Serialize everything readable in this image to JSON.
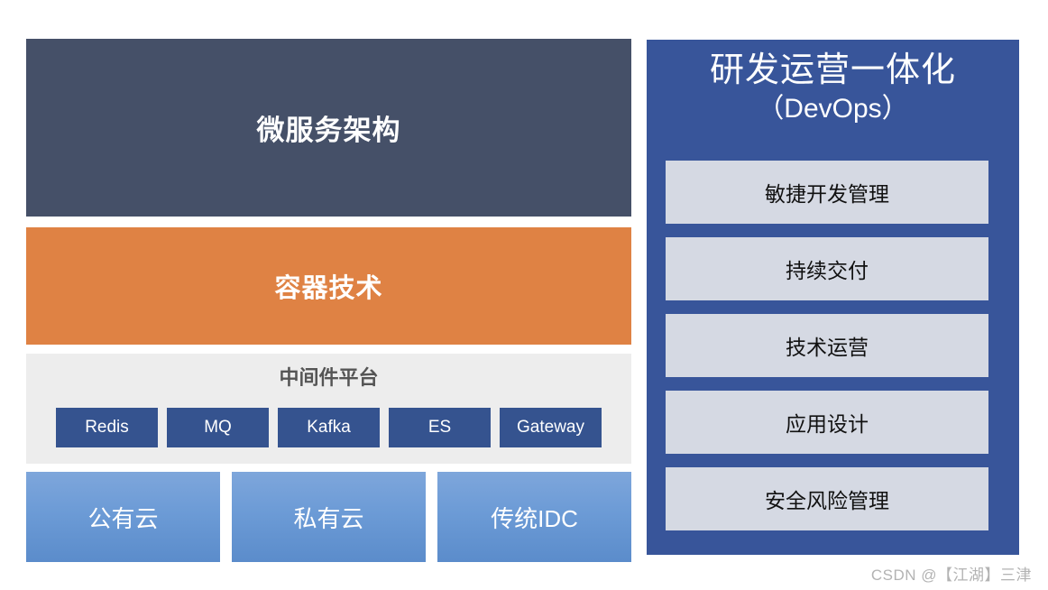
{
  "left_column": {
    "microservices": {
      "label": "微服务架构",
      "color": "#455068"
    },
    "container_tech": {
      "label": "容器技术",
      "color": "#DF8244"
    },
    "middleware": {
      "title": "中间件平台",
      "color": "#EDEDED",
      "chip_color": "#35538F",
      "chips": [
        {
          "label": "Redis"
        },
        {
          "label": "MQ"
        },
        {
          "label": "Kafka"
        },
        {
          "label": "ES"
        },
        {
          "label": "Gateway"
        }
      ]
    },
    "infrastructure": {
      "color": "#6C9BD6",
      "items": [
        {
          "label": "公有云"
        },
        {
          "label": "私有云"
        },
        {
          "label": "传统IDC"
        }
      ]
    }
  },
  "devops_panel": {
    "title": "研发运营一体化",
    "subtitle": "（DevOps）",
    "panel_color": "#38559A",
    "item_color": "#D5D9E3",
    "items": [
      {
        "label": "敏捷开发管理"
      },
      {
        "label": "持续交付"
      },
      {
        "label": "技术运营"
      },
      {
        "label": "应用设计"
      },
      {
        "label": "安全风险管理"
      }
    ]
  },
  "watermark": {
    "text": "CSDN @【江湖】三津"
  }
}
